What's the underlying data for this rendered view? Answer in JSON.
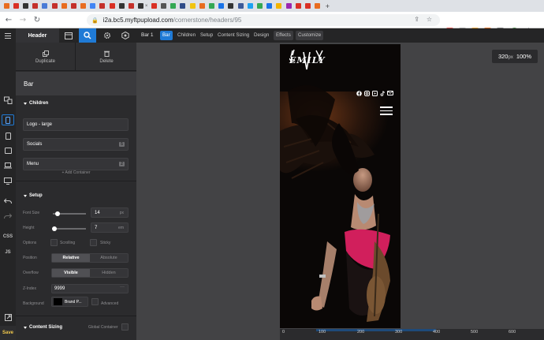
{
  "browser": {
    "url_host": "i2a.bc5.myftpupload.com",
    "url_path": "/cornerstone/headers/95",
    "tab_close_glyph": "×",
    "new_tab_glyph": "+",
    "tab_colors": [
      "#e86c1f",
      "#d93025",
      "#333333",
      "#c4302b",
      "#4a7bd6",
      "#c4302b",
      "#e86c1f",
      "#c4302b",
      "#e86c1f",
      "#4285f4",
      "#c4302b",
      "#d93025",
      "#333333",
      "#c4302b",
      "#333333",
      "#d93025",
      "#555555",
      "#34a853",
      "#2f4b88",
      "#f1c40f",
      "#e86c1f",
      "#34a853",
      "#1a73e8",
      "#333333",
      "#3c5a99",
      "#1da1f2",
      "#34a853",
      "#1a73e8",
      "#f4b400",
      "#9c27b0",
      "#d93025",
      "#d93025",
      "#e86c1f"
    ]
  },
  "topbar": {
    "header_tab": "Header",
    "breadcrumb": "Bar 1",
    "tabs": [
      "Bar",
      "Children",
      "Setup",
      "Content Sizing",
      "Design",
      "Effects",
      "Customize"
    ]
  },
  "rail": {
    "css": "CSS",
    "js": "JS",
    "save": "Save"
  },
  "panel": {
    "duplicate": "Duplicate",
    "delete": "Delete",
    "element_title": "Bar",
    "children_heading": "Children",
    "children": [
      {
        "label": "Logo - large",
        "badge": ""
      },
      {
        "label": "Socials",
        "badge": "5"
      },
      {
        "label": "Menu",
        "badge": "2"
      }
    ],
    "add_container": "+ Add Container",
    "setup_heading": "Setup",
    "font_size_label": "Font Size",
    "font_size_value": "14",
    "font_size_unit": "px",
    "font_size_slider": 0.15,
    "height_label": "Height",
    "height_value": "7",
    "height_unit": "em",
    "height_slider": 0.05,
    "options_label": "Options",
    "opt_scrolling": "Scrolling",
    "opt_sticky": "Sticky",
    "position_label": "Position",
    "position_options": [
      "Relative",
      "Absolute"
    ],
    "overflow_label": "Overflow",
    "overflow_options": [
      "Visible",
      "Hidden"
    ],
    "zindex_label": "Z-Index",
    "zindex_value": "9999",
    "zindex_more": "···",
    "background_label": "Background",
    "background_value": "Brand P...",
    "bg_advanced": "Advanced",
    "content_sizing_heading": "Content Sizing",
    "global_container": "Global Container"
  },
  "canvas": {
    "width_value": "320",
    "width_unit": "px",
    "zoom": "100%",
    "logo_text": "EMILY",
    "ruler_ticks": [
      "0",
      "100",
      "200",
      "300",
      "400",
      "500",
      "600"
    ]
  }
}
